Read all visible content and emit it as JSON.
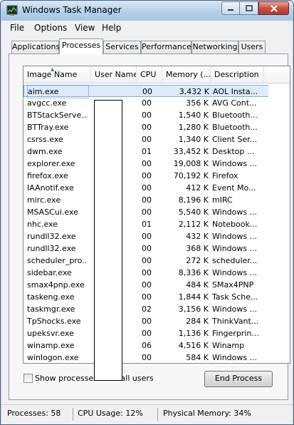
{
  "window": {
    "title": "Windows Task Manager"
  },
  "menu": [
    {
      "label": "File"
    },
    {
      "label": "Options"
    },
    {
      "label": "View"
    },
    {
      "label": "Help"
    }
  ],
  "tabs": [
    {
      "label": "Applications"
    },
    {
      "label": "Processes"
    },
    {
      "label": "Services"
    },
    {
      "label": "Performance"
    },
    {
      "label": "Networking"
    },
    {
      "label": "Users"
    }
  ],
  "columns": [
    {
      "label": "Image Name"
    },
    {
      "label": "User Name"
    },
    {
      "label": "CPU"
    },
    {
      "label": "Memory (..."
    },
    {
      "label": "Description"
    }
  ],
  "processes": [
    {
      "name": "aim.exe",
      "cpu": "00",
      "memory": "3,432 K",
      "description": "AOL Insta..."
    },
    {
      "name": "avgcc.exe",
      "cpu": "00",
      "memory": "356 K",
      "description": "AVG Cont..."
    },
    {
      "name": "BTStackServe...",
      "cpu": "00",
      "memory": "1,540 K",
      "description": "Bluetooth..."
    },
    {
      "name": "BTTray.exe",
      "cpu": "00",
      "memory": "1,280 K",
      "description": "Bluetooth..."
    },
    {
      "name": "csrss.exe",
      "cpu": "00",
      "memory": "1,340 K",
      "description": "Client Ser..."
    },
    {
      "name": "dwm.exe",
      "cpu": "01",
      "memory": "33,452 K",
      "description": "Desktop ..."
    },
    {
      "name": "explorer.exe",
      "cpu": "00",
      "memory": "19,008 K",
      "description": "Windows ..."
    },
    {
      "name": "firefox.exe",
      "cpu": "00",
      "memory": "70,192 K",
      "description": "Firefox"
    },
    {
      "name": "IAAnotif.exe",
      "cpu": "00",
      "memory": "412 K",
      "description": "Event Mo..."
    },
    {
      "name": "mirc.exe",
      "cpu": "00",
      "memory": "8,196 K",
      "description": "mIRC"
    },
    {
      "name": "MSASCui.exe",
      "cpu": "00",
      "memory": "5,540 K",
      "description": "Windows ..."
    },
    {
      "name": "nhc.exe",
      "cpu": "01",
      "memory": "2,112 K",
      "description": "Notebook..."
    },
    {
      "name": "rundll32.exe",
      "cpu": "00",
      "memory": "432 K",
      "description": "Windows ..."
    },
    {
      "name": "rundll32.exe",
      "cpu": "00",
      "memory": "368 K",
      "description": "Windows ..."
    },
    {
      "name": "scheduler_pro...",
      "cpu": "00",
      "memory": "272 K",
      "description": "scheduler..."
    },
    {
      "name": "sidebar.exe",
      "cpu": "00",
      "memory": "8,336 K",
      "description": "Windows ..."
    },
    {
      "name": "smax4pnp.exe",
      "cpu": "00",
      "memory": "484 K",
      "description": "SMax4PNP"
    },
    {
      "name": "taskeng.exe",
      "cpu": "00",
      "memory": "1,844 K",
      "description": "Task Sche..."
    },
    {
      "name": "taskmgr.exe",
      "cpu": "02",
      "memory": "3,156 K",
      "description": "Windows ..."
    },
    {
      "name": "TpShocks.exe",
      "cpu": "00",
      "memory": "284 K",
      "description": "ThinkVant..."
    },
    {
      "name": "upeksvr.exe",
      "cpu": "00",
      "memory": "1,136 K",
      "description": "Fingerprin..."
    },
    {
      "name": "winamp.exe",
      "cpu": "06",
      "memory": "4,516 K",
      "description": "Winamp"
    },
    {
      "name": "winlogon.exe",
      "cpu": "00",
      "memory": "584 K",
      "description": "Windows ..."
    }
  ],
  "options": {
    "show_all_label": "Show processes from all users",
    "end_process_label": "End Process"
  },
  "status": {
    "processes": "Processes: 58",
    "cpu": "CPU Usage: 12%",
    "memory": "Physical Memory: 34%"
  }
}
